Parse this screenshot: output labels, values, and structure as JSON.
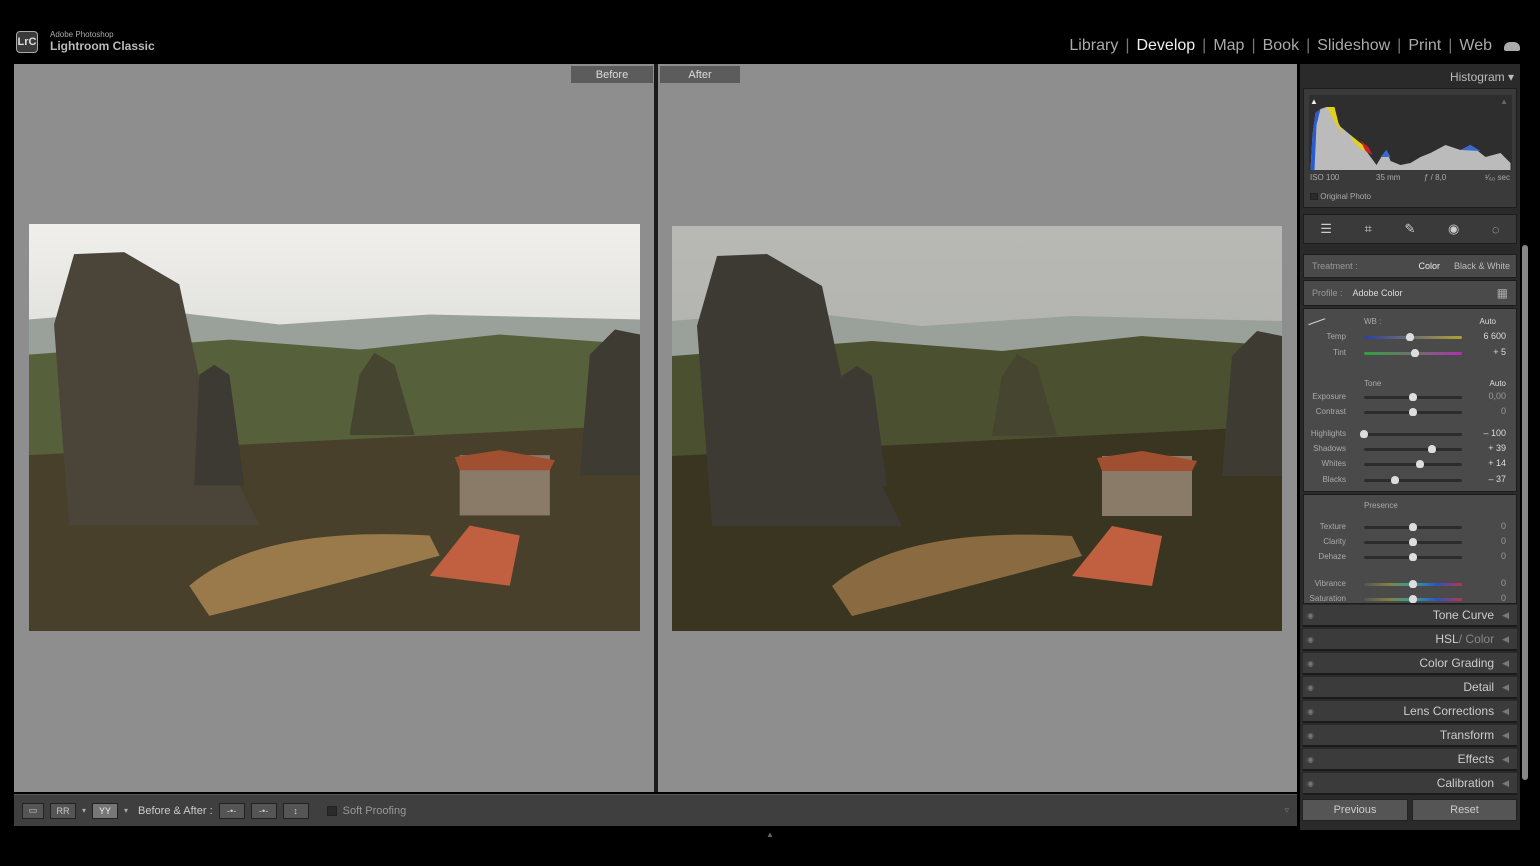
{
  "app": {
    "logo": "LrC",
    "brand_small": "Adobe Photoshop",
    "brand_big": "Lightroom Classic"
  },
  "modules": [
    {
      "label": "Library"
    },
    {
      "label": "Develop",
      "active": true
    },
    {
      "label": "Map"
    },
    {
      "label": "Book"
    },
    {
      "label": "Slideshow"
    },
    {
      "label": "Print"
    },
    {
      "label": "Web"
    }
  ],
  "view": {
    "before_label": "Before",
    "after_label": "After"
  },
  "toolbar": {
    "before_after_label": "Before & After :",
    "soft_proofing": "Soft Proofing",
    "survey_icon": "YY",
    "compare_icon": "RR"
  },
  "histogram": {
    "title": "Histogram",
    "iso": "ISO 100",
    "focal": "35 mm",
    "aperture": "ƒ / 8,0",
    "shutter": "¹⁄₆₀ sec",
    "original_photo": "Original Photo"
  },
  "tools": [
    "edit-sliders-icon",
    "crop-icon",
    "healing-icon",
    "redeye-icon",
    "mask-icon"
  ],
  "basic": {
    "treatment_label": "Treatment :",
    "treatment_color": "Color",
    "treatment_bw": "Black & White",
    "profile_label": "Profile :",
    "profile_value": "Adobe Color",
    "wb_label": "WB :",
    "wb_value": "Auto",
    "tone_label": "Tone",
    "tone_auto": "Auto",
    "presence_label": "Presence",
    "sliders": [
      {
        "label": "Temp",
        "value": "6 600",
        "position": 0.47,
        "group": "wb"
      },
      {
        "label": "Tint",
        "value": "+ 5",
        "position": 0.52,
        "group": "wb"
      },
      {
        "label": "Exposure",
        "value": "0,00",
        "position": 0.5,
        "group": "tone"
      },
      {
        "label": "Contrast",
        "value": "0",
        "position": 0.5,
        "group": "tone"
      },
      {
        "label": "Highlights",
        "value": "– 100",
        "position": 0.0,
        "group": "tone"
      },
      {
        "label": "Shadows",
        "value": "+ 39",
        "position": 0.695,
        "group": "tone"
      },
      {
        "label": "Whites",
        "value": "+ 14",
        "position": 0.57,
        "group": "tone"
      },
      {
        "label": "Blacks",
        "value": "– 37",
        "position": 0.315,
        "group": "tone"
      },
      {
        "label": "Texture",
        "value": "0",
        "position": 0.5,
        "group": "presence"
      },
      {
        "label": "Clarity",
        "value": "0",
        "position": 0.5,
        "group": "presence"
      },
      {
        "label": "Dehaze",
        "value": "0",
        "position": 0.5,
        "group": "presence"
      },
      {
        "label": "Vibrance",
        "value": "0",
        "position": 0.5,
        "group": "presence"
      },
      {
        "label": "Saturation",
        "value": "0",
        "position": 0.5,
        "group": "presence"
      }
    ]
  },
  "panels": [
    {
      "label": "Tone Curve"
    },
    {
      "label": "HSL",
      "suffix": "/ Color"
    },
    {
      "label": "Color Grading"
    },
    {
      "label": "Detail"
    },
    {
      "label": "Lens Corrections"
    },
    {
      "label": "Transform"
    },
    {
      "label": "Effects"
    },
    {
      "label": "Calibration"
    }
  ],
  "buttons": {
    "previous": "Previous",
    "reset": "Reset"
  }
}
